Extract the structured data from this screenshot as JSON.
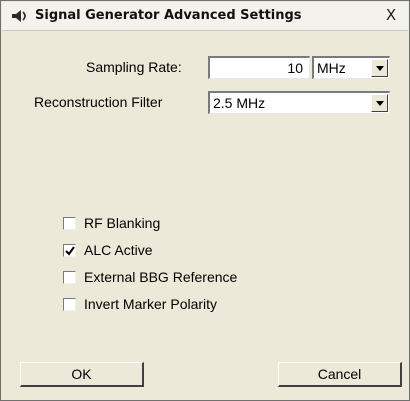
{
  "window": {
    "title": "Signal Generator Advanced Settings",
    "title_icon": "speaker-icon",
    "close_glyph": "X"
  },
  "sampling_rate": {
    "label": "Sampling Rate:",
    "value": "10",
    "unit": "MHz"
  },
  "reconstruction_filter": {
    "label": "Reconstruction Filter",
    "value": "2.5 MHz"
  },
  "options": [
    {
      "label": "RF Blanking",
      "checked": false
    },
    {
      "label": "ALC Active",
      "checked": true
    },
    {
      "label": "External BBG Reference",
      "checked": false
    },
    {
      "label": "Invert Marker Polarity",
      "checked": false
    }
  ],
  "buttons": {
    "ok": "OK",
    "cancel": "Cancel"
  }
}
